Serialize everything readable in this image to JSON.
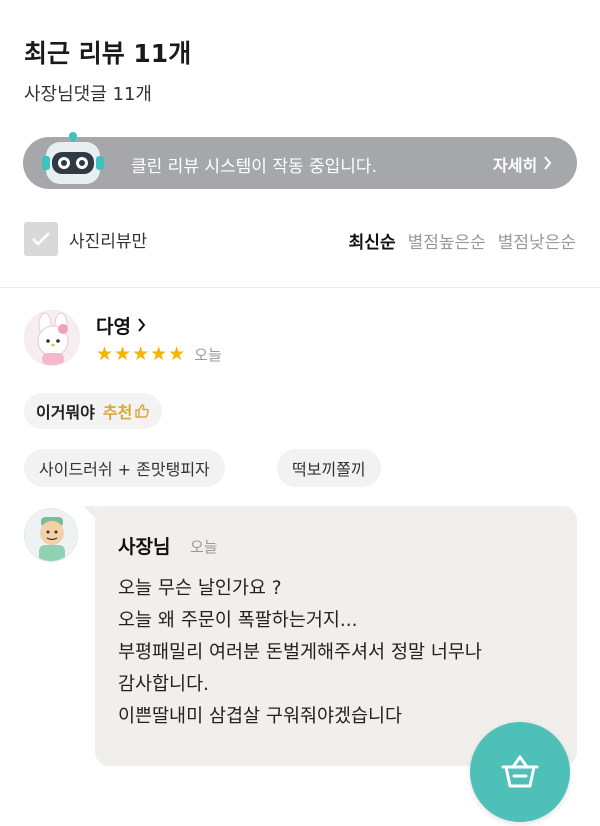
{
  "header": {
    "title": "최근 리뷰 11개",
    "owner_reply_count": "사장님댓글 11개"
  },
  "banner": {
    "text": "클린 리뷰 시스템이 작동 중입니다.",
    "detail_label": "자세히",
    "background": "#a5a7ab"
  },
  "filter": {
    "photo_only_label": "사진리뷰만",
    "sort_options": [
      "최신순",
      "별점높은순",
      "별점낮은순"
    ],
    "active_sort": "최신순"
  },
  "review": {
    "user_name": "다영",
    "rating": 5,
    "stars": "★★★★★",
    "date": "오늘",
    "recommend": {
      "item": "이거뭐야",
      "word": "추천"
    },
    "menu_items": [
      "사이드러쉬 + 존맛탱피자",
      "떡보끼쫄끼"
    ]
  },
  "owner_reply": {
    "name": "사장님",
    "date": "오늘",
    "lines": [
      "오늘 무슨 날인가요 ?",
      "오늘 왜 주문이 폭팔하는거지...",
      "부평패밀리 여러분 돈벌게해주셔서 정말 너무나",
      "감사합니다.",
      "이쁜딸내미 삼겹살 구워줘야겠습니다"
    ]
  },
  "colors": {
    "accent": "#4fc0b8",
    "star": "#f5b400",
    "recommend": "#d9a63a"
  },
  "icons": {
    "cart": "basket-icon",
    "thumbs": "thumbs-up-icon",
    "robot": "robot-mascot-icon"
  }
}
